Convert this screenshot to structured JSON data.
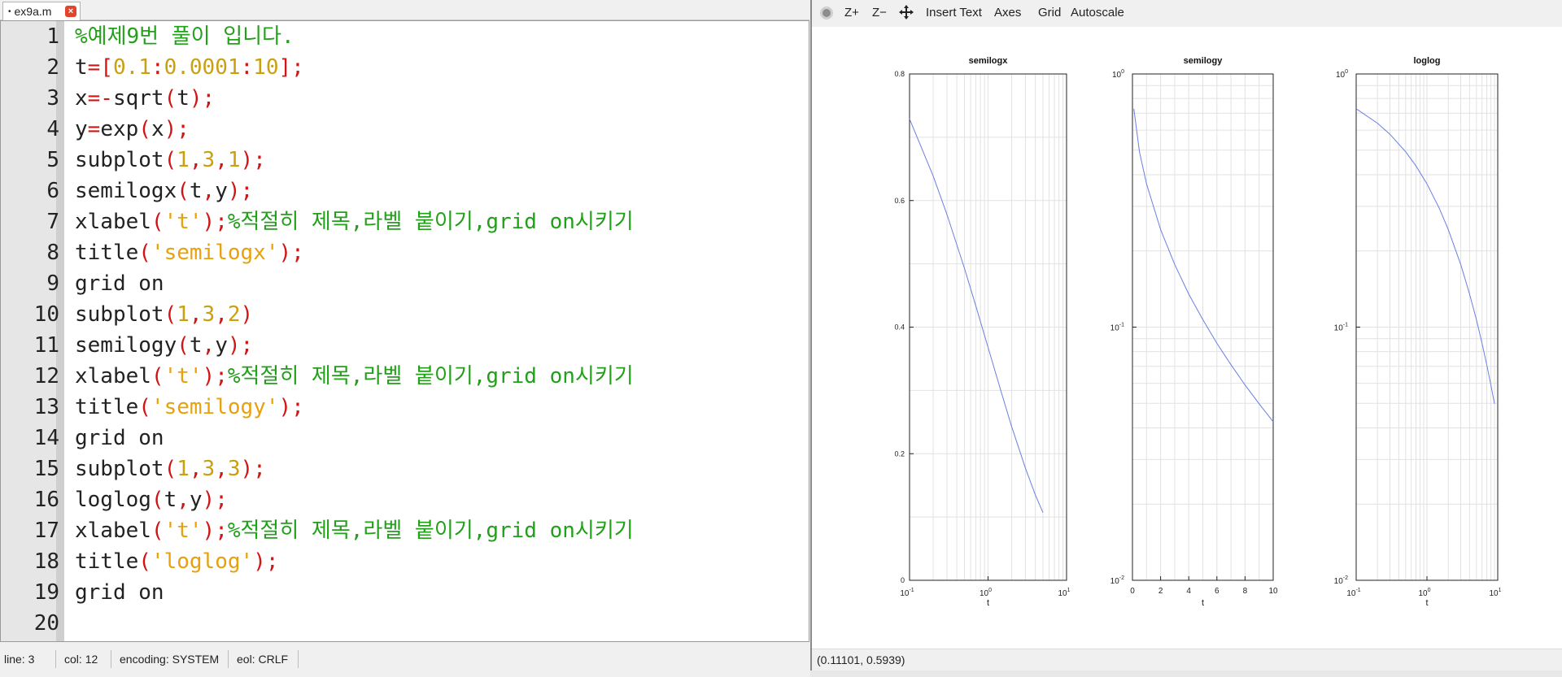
{
  "editor": {
    "tab": {
      "modified_marker": "•",
      "name": "ex9a.m",
      "close_icon": "close-icon"
    },
    "lines": [
      {
        "num": "1",
        "tokens": [
          [
            "c-comment",
            "%예제9번 풀이 입니다."
          ]
        ]
      },
      {
        "num": "2",
        "tokens": [
          [
            "c-plain",
            "t"
          ],
          [
            "c-op",
            "="
          ],
          [
            "c-op",
            "["
          ],
          [
            "c-num",
            "0.1"
          ],
          [
            "c-op",
            ":"
          ],
          [
            "c-num",
            "0.0001"
          ],
          [
            "c-op",
            ":"
          ],
          [
            "c-num",
            "10"
          ],
          [
            "c-op",
            "];"
          ]
        ]
      },
      {
        "num": "3",
        "tokens": [
          [
            "c-plain",
            "x"
          ],
          [
            "c-op",
            "=-"
          ],
          [
            "c-plain",
            "sqrt"
          ],
          [
            "c-op",
            "("
          ],
          [
            "c-plain",
            "t"
          ],
          [
            "c-op",
            ");"
          ]
        ]
      },
      {
        "num": "4",
        "tokens": [
          [
            "c-plain",
            "y"
          ],
          [
            "c-op",
            "="
          ],
          [
            "c-plain",
            "exp"
          ],
          [
            "c-op",
            "("
          ],
          [
            "c-plain",
            "x"
          ],
          [
            "c-op",
            ");"
          ]
        ]
      },
      {
        "num": "5",
        "tokens": [
          [
            "c-plain",
            "subplot"
          ],
          [
            "c-op",
            "("
          ],
          [
            "c-num",
            "1"
          ],
          [
            "c-op",
            ","
          ],
          [
            "c-num",
            "3"
          ],
          [
            "c-op",
            ","
          ],
          [
            "c-num",
            "1"
          ],
          [
            "c-op",
            ");"
          ]
        ]
      },
      {
        "num": "6",
        "tokens": [
          [
            "c-plain",
            "semilogx"
          ],
          [
            "c-op",
            "("
          ],
          [
            "c-plain",
            "t"
          ],
          [
            "c-op",
            ","
          ],
          [
            "c-plain",
            "y"
          ],
          [
            "c-op",
            ");"
          ]
        ]
      },
      {
        "num": "7",
        "tokens": [
          [
            "c-plain",
            "xlabel"
          ],
          [
            "c-op",
            "("
          ],
          [
            "c-str",
            "'t'"
          ],
          [
            "c-op",
            ");"
          ],
          [
            "c-comment",
            "%적절히 제목,라벨 붙이기,grid on시키기"
          ]
        ]
      },
      {
        "num": "8",
        "tokens": [
          [
            "c-plain",
            "title"
          ],
          [
            "c-op",
            "("
          ],
          [
            "c-str",
            "'semilogx'"
          ],
          [
            "c-op",
            ");"
          ]
        ]
      },
      {
        "num": "9",
        "tokens": [
          [
            "c-plain",
            "grid on"
          ]
        ]
      },
      {
        "num": "10",
        "tokens": [
          [
            "c-plain",
            "subplot"
          ],
          [
            "c-op",
            "("
          ],
          [
            "c-num",
            "1"
          ],
          [
            "c-op",
            ","
          ],
          [
            "c-num",
            "3"
          ],
          [
            "c-op",
            ","
          ],
          [
            "c-num",
            "2"
          ],
          [
            "c-op",
            ")"
          ]
        ]
      },
      {
        "num": "11",
        "tokens": [
          [
            "c-plain",
            "semilogy"
          ],
          [
            "c-op",
            "("
          ],
          [
            "c-plain",
            "t"
          ],
          [
            "c-op",
            ","
          ],
          [
            "c-plain",
            "y"
          ],
          [
            "c-op",
            ");"
          ]
        ]
      },
      {
        "num": "12",
        "tokens": [
          [
            "c-plain",
            "xlabel"
          ],
          [
            "c-op",
            "("
          ],
          [
            "c-str",
            "'t'"
          ],
          [
            "c-op",
            ");"
          ],
          [
            "c-comment",
            "%적절히 제목,라벨 붙이기,grid on시키기"
          ]
        ]
      },
      {
        "num": "13",
        "tokens": [
          [
            "c-plain",
            "title"
          ],
          [
            "c-op",
            "("
          ],
          [
            "c-str",
            "'semilogy'"
          ],
          [
            "c-op",
            ");"
          ]
        ]
      },
      {
        "num": "14",
        "tokens": [
          [
            "c-plain",
            "grid on"
          ]
        ]
      },
      {
        "num": "15",
        "tokens": [
          [
            "c-plain",
            "subplot"
          ],
          [
            "c-op",
            "("
          ],
          [
            "c-num",
            "1"
          ],
          [
            "c-op",
            ","
          ],
          [
            "c-num",
            "3"
          ],
          [
            "c-op",
            ","
          ],
          [
            "c-num",
            "3"
          ],
          [
            "c-op",
            ");"
          ]
        ]
      },
      {
        "num": "16",
        "tokens": [
          [
            "c-plain",
            "loglog"
          ],
          [
            "c-op",
            "("
          ],
          [
            "c-plain",
            "t"
          ],
          [
            "c-op",
            ","
          ],
          [
            "c-plain",
            "y"
          ],
          [
            "c-op",
            ");"
          ]
        ]
      },
      {
        "num": "17",
        "tokens": [
          [
            "c-plain",
            "xlabel"
          ],
          [
            "c-op",
            "("
          ],
          [
            "c-str",
            "'t'"
          ],
          [
            "c-op",
            ");"
          ],
          [
            "c-comment",
            "%적절히 제목,라벨 붙이기,grid on시키기"
          ]
        ]
      },
      {
        "num": "18",
        "tokens": [
          [
            "c-plain",
            "title"
          ],
          [
            "c-op",
            "("
          ],
          [
            "c-str",
            "'loglog'"
          ],
          [
            "c-op",
            ");"
          ]
        ]
      },
      {
        "num": "19",
        "tokens": [
          [
            "c-plain",
            "grid on"
          ]
        ]
      },
      {
        "num": "20",
        "tokens": []
      }
    ],
    "status": {
      "line_label": "line:",
      "line_value": "3",
      "col_label": "col:",
      "col_value": "12",
      "encoding_label": "encoding:",
      "encoding_value": "SYSTEM",
      "eol_label": "eol:",
      "eol_value": "CRLF"
    }
  },
  "figure": {
    "toolbar": {
      "gear_icon": "gear-icon",
      "zoom_in": "Z+",
      "zoom_out": "Z−",
      "pan_icon": "pan-icon",
      "insert_text": "Insert Text",
      "axes": "Axes",
      "grid": "Grid",
      "autoscale": "Autoscale"
    },
    "coordinate_readout": "(0.11101, 0.5939)",
    "line_color": "#6a7fe0"
  },
  "chart_data": [
    {
      "type": "line",
      "title": "semilogx",
      "xlabel": "t",
      "xscale": "log",
      "yscale": "linear",
      "xlim": [
        0.1,
        10
      ],
      "ylim": [
        0,
        0.8
      ],
      "xticks": [
        {
          "v": 0.1,
          "base": "10",
          "exp": "-1"
        },
        {
          "v": 1,
          "base": "10",
          "exp": "0"
        },
        {
          "v": 10,
          "base": "10",
          "exp": "1"
        }
      ],
      "yticks": [
        "0",
        "0.2",
        "0.4",
        "0.6",
        "0.8"
      ],
      "grid": true,
      "series": [
        {
          "x": [
            0.1,
            0.2,
            0.3,
            0.5,
            0.7,
            1,
            1.5,
            2,
            3,
            4,
            5
          ],
          "y": [
            0.729,
            0.639,
            0.578,
            0.493,
            0.433,
            0.368,
            0.294,
            0.243,
            0.177,
            0.135,
            0.107
          ]
        }
      ]
    },
    {
      "type": "line",
      "title": "semilogy",
      "xlabel": "t",
      "xscale": "linear",
      "yscale": "log",
      "xlim": [
        0,
        10
      ],
      "ylim": [
        0.01,
        1
      ],
      "xticks": [
        "0",
        "2",
        "4",
        "6",
        "8",
        "10"
      ],
      "yticks": [
        {
          "v": 0.01,
          "base": "10",
          "exp": "-2"
        },
        {
          "v": 0.1,
          "base": "10",
          "exp": "-1"
        },
        {
          "v": 1,
          "base": "10",
          "exp": "0"
        }
      ],
      "grid": true,
      "series": [
        {
          "x": [
            0.1,
            0.5,
            1,
            2,
            3,
            4,
            5,
            6,
            7,
            8,
            9,
            10
          ],
          "y": [
            0.729,
            0.493,
            0.368,
            0.243,
            0.177,
            0.135,
            0.107,
            0.0863,
            0.071,
            0.0591,
            0.0498,
            0.0423
          ]
        }
      ]
    },
    {
      "type": "line",
      "title": "loglog",
      "xlabel": "t",
      "xscale": "log",
      "yscale": "log",
      "xlim": [
        0.1,
        10
      ],
      "ylim": [
        0.01,
        1
      ],
      "xticks": [
        {
          "v": 0.1,
          "base": "10",
          "exp": "-1"
        },
        {
          "v": 1,
          "base": "10",
          "exp": "0"
        },
        {
          "v": 10,
          "base": "10",
          "exp": "1"
        }
      ],
      "yticks": [
        {
          "v": 0.01,
          "base": "10",
          "exp": "-2"
        },
        {
          "v": 0.1,
          "base": "10",
          "exp": "-1"
        },
        {
          "v": 1,
          "base": "10",
          "exp": "0"
        }
      ],
      "grid": true,
      "series": [
        {
          "x": [
            0.1,
            0.2,
            0.3,
            0.5,
            0.7,
            1,
            1.5,
            2,
            3,
            4,
            5,
            6,
            7,
            8,
            9
          ],
          "y": [
            0.729,
            0.639,
            0.578,
            0.493,
            0.433,
            0.368,
            0.294,
            0.243,
            0.177,
            0.135,
            0.107,
            0.0863,
            0.071,
            0.0591,
            0.0498
          ]
        }
      ]
    }
  ]
}
